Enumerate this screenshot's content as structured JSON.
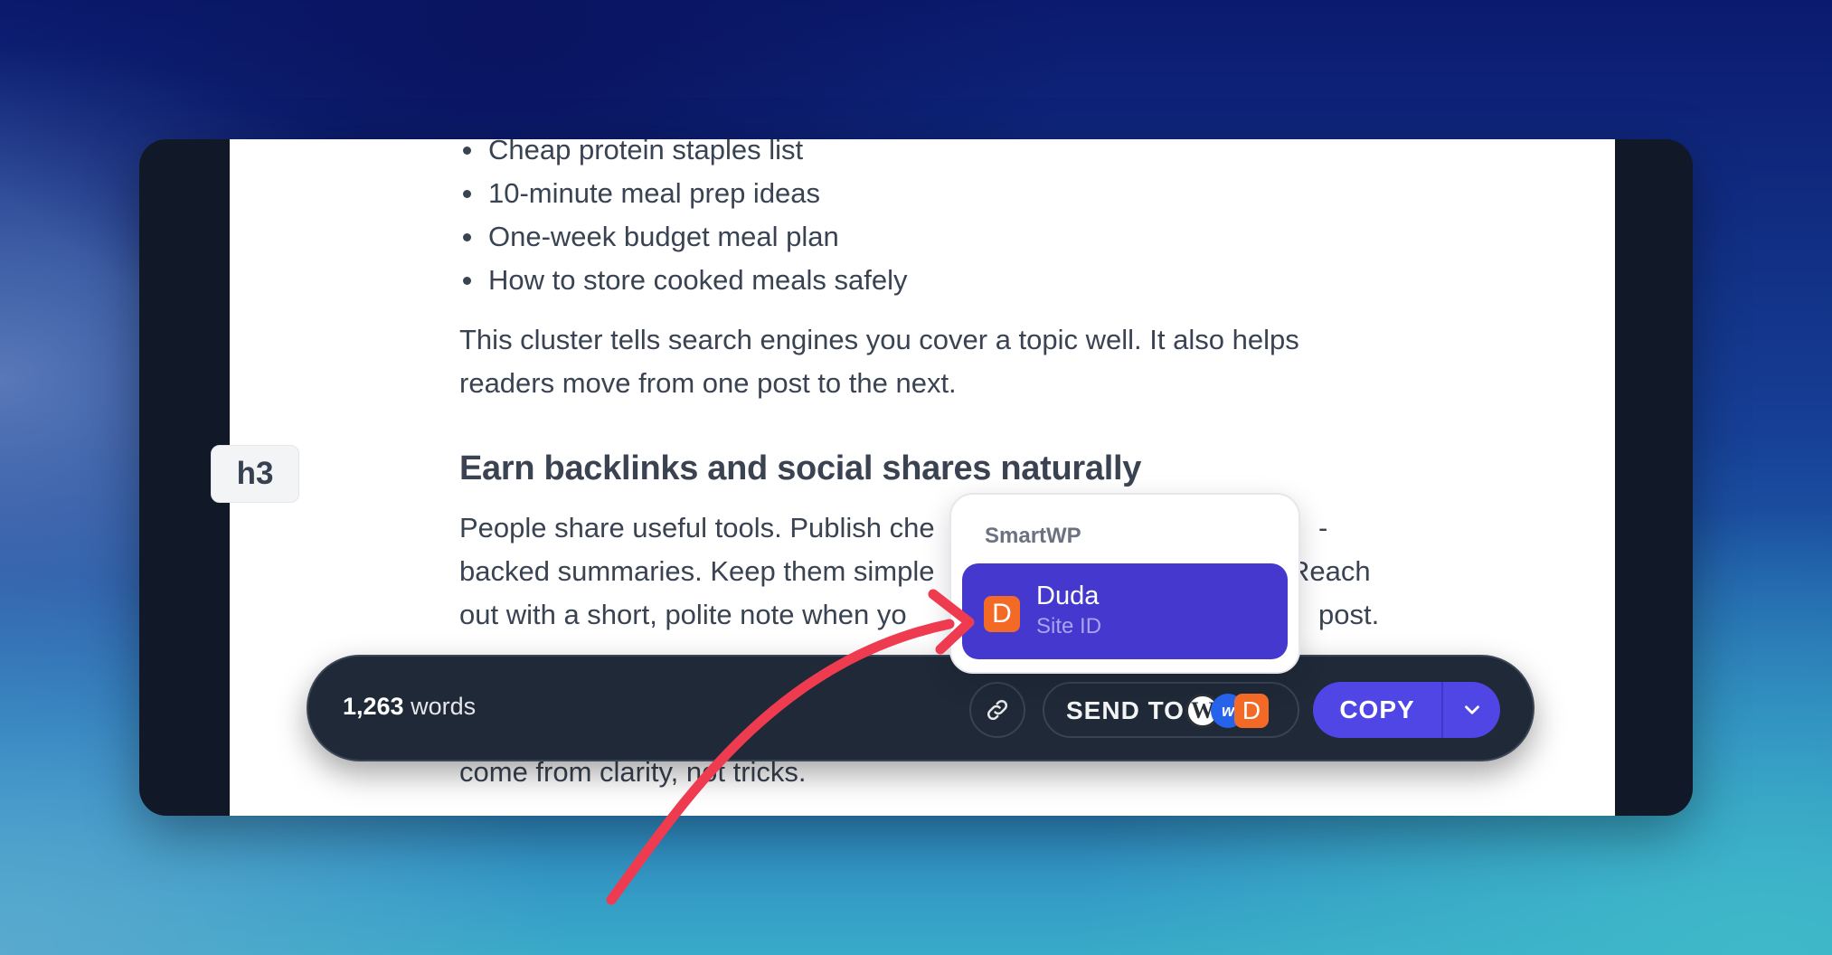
{
  "document": {
    "bullets": [
      "Cheap protein staples list",
      "10-minute meal prep ideas",
      "One-week budget meal plan",
      "How to store cooked meals safely"
    ],
    "paragraph_1": [
      "This cluster tells search engines you cover a topic well. It also helps",
      "readers move from one post to the next."
    ],
    "heading_tag": "h3",
    "heading": "Earn backlinks and social shares naturally",
    "paragraph_2": [
      "People share useful tools. Publish che",
      "backed summaries. Keep them simple",
      "out with a short, polite note when yo"
    ],
    "paragraph_2_right": [
      "-",
      "Reach",
      "post."
    ],
    "paragraph_3_fragment": "come from clarity, not tricks."
  },
  "toolbar": {
    "word_count": "1,263",
    "word_count_unit": "words",
    "link_icon": "link-icon",
    "send_to_label": "SEND TO",
    "send_to_logos": [
      "wordpress-logo-icon",
      "webflow-logo-icon",
      "duda-logo-icon"
    ],
    "wp_glyph": "W",
    "wf_glyph": "w",
    "duda_glyph": "D",
    "copy_label": "COPY",
    "dropdown_icon": "chevron-down-icon"
  },
  "popover": {
    "section_label": "SmartWP",
    "item": {
      "badge": "D",
      "name": "Duda",
      "sub": "Site ID"
    }
  },
  "colors": {
    "accent": "#4f46e5",
    "selected_item": "#4438cf",
    "duda_orange": "#f26a26",
    "arrow": "#ef3b4f",
    "toolbar_bg": "#1f2937"
  }
}
